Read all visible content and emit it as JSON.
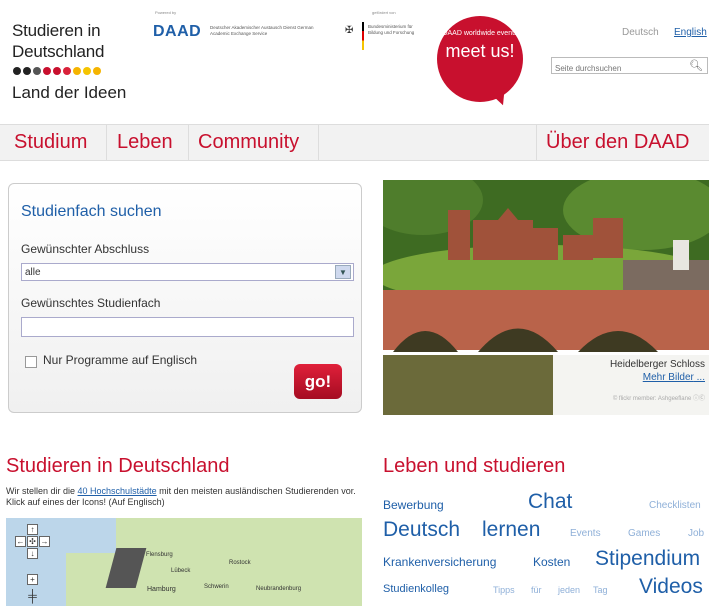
{
  "header": {
    "logo": {
      "line1": "Studieren in",
      "line2": "Deutschland",
      "line3": "Land der Ideen",
      "dots": [
        "#222222",
        "#222222",
        "#555555",
        "#c8102e",
        "#c8102e",
        "#d9223a",
        "#f5b400",
        "#f5c400",
        "#f5b400"
      ]
    },
    "powered_by": "Powered by",
    "daad_logo": "DAAD",
    "daad_text": "Deutscher Akademischer Austausch Dienst German Academic Exchange Service",
    "supported_by": "gefördert von",
    "bmbf_text": "Bundesministerium für Bildung und Forschung",
    "meetus": {
      "small": "DAAD worldwide events",
      "big": "meet us!"
    },
    "lang_de": "Deutsch",
    "lang_en": "English",
    "search_placeholder": "Seite durchsuchen"
  },
  "nav": {
    "items": [
      {
        "label": "Studium"
      },
      {
        "label": "Leben"
      },
      {
        "label": "Community"
      }
    ],
    "right": "Über den DAAD"
  },
  "search": {
    "title": "Studienfach suchen",
    "degree_label": "Gewünschter Abschluss",
    "degree_value": "alle",
    "subject_label": "Gewünschtes Studienfach",
    "english_only": "Nur Programme auf Englisch",
    "go": "go!"
  },
  "photo": {
    "caption": "Heidelberger Schloss",
    "more": "Mehr Bilder",
    "credit": "© flickr member: Ashgeeflane",
    "colors": {
      "sky": "#9fc3dc",
      "forest": "#3e6b22",
      "castle": "#a0523a",
      "bridge": "#b9634a",
      "water": "#6b6a3a"
    }
  },
  "left_section": {
    "title": "Studieren in Deutschland",
    "intro_before": "Wir stellen dir die ",
    "intro_link": "40 Hochschulstädte",
    "intro_after": " mit den meisten ausländischen Studierenden vor. Klick auf eines der Icons! (Auf Englisch)",
    "cities": [
      "Flensburg",
      "Lübeck",
      "Rostock",
      "Hamburg",
      "Schwerin",
      "Neubrandenburg"
    ]
  },
  "right_section": {
    "title": "Leben und studieren",
    "tags": [
      {
        "text": "Bewerbung"
      },
      {
        "text": "Chat"
      },
      {
        "text": "Checklisten"
      },
      {
        "text": "Deutsch"
      },
      {
        "text": "lernen"
      },
      {
        "text": "Events"
      },
      {
        "text": "Games"
      },
      {
        "text": "Job"
      },
      {
        "text": "Krankenversicherung"
      },
      {
        "text": "Kosten"
      },
      {
        "text": "Stipendium"
      },
      {
        "text": "Studienkolleg"
      },
      {
        "text": "Tipps"
      },
      {
        "text": "für"
      },
      {
        "text": "jeden"
      },
      {
        "text": "Tag"
      },
      {
        "text": "Videos"
      }
    ]
  }
}
